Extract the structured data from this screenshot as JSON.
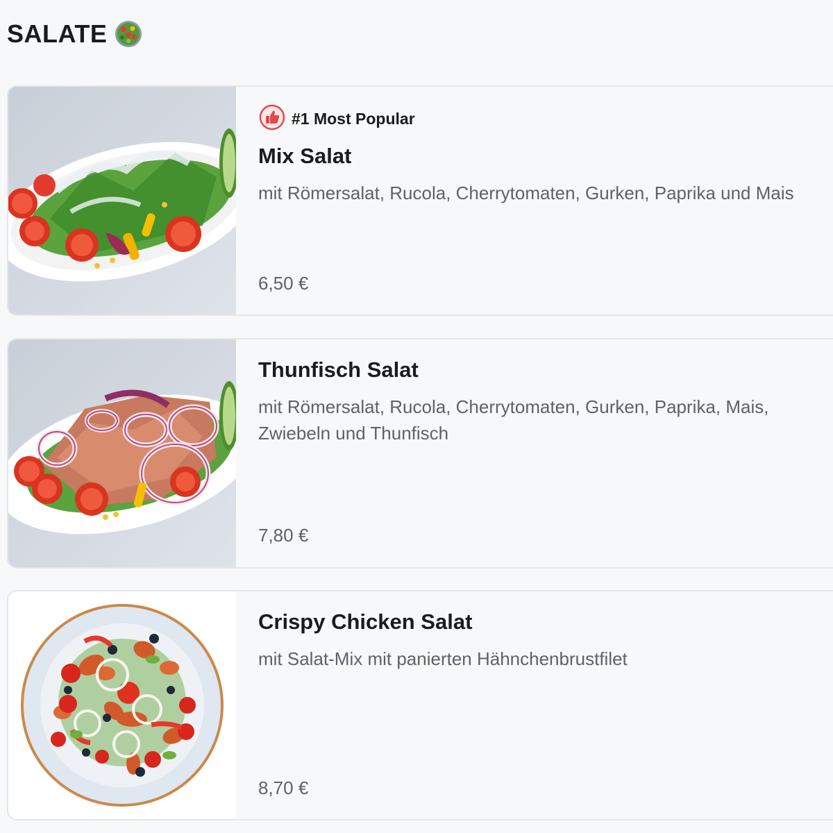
{
  "section": {
    "title": "SALATE",
    "icon": "salad-bowl-emoji"
  },
  "accent_color": "#e5484d",
  "items": [
    {
      "badge": "#1 Most Popular",
      "badge_icon": "thumbs-up-icon",
      "name": "Mix Salat",
      "description_lines": [
        "mit Römersalat, Rucola, Cherrytomaten, Gurken, Paprika und Mais"
      ],
      "price": "6,50 €",
      "image": "mix-salad-image"
    },
    {
      "name": "Thunfisch Salat",
      "description_lines": [
        "mit Römersalat, Rucola, Cherrytomaten, Gurken, Paprika, Mais,",
        "Zwiebeln und Thunfisch"
      ],
      "price": "7,80 €",
      "image": "tuna-salad-image"
    },
    {
      "name": "Crispy Chicken Salat",
      "description_lines": [
        "mit Salat-Mix mit panierten Hähnchenbrustfilet"
      ],
      "price": "8,70 €",
      "image": "crispy-chicken-salad-image"
    }
  ]
}
